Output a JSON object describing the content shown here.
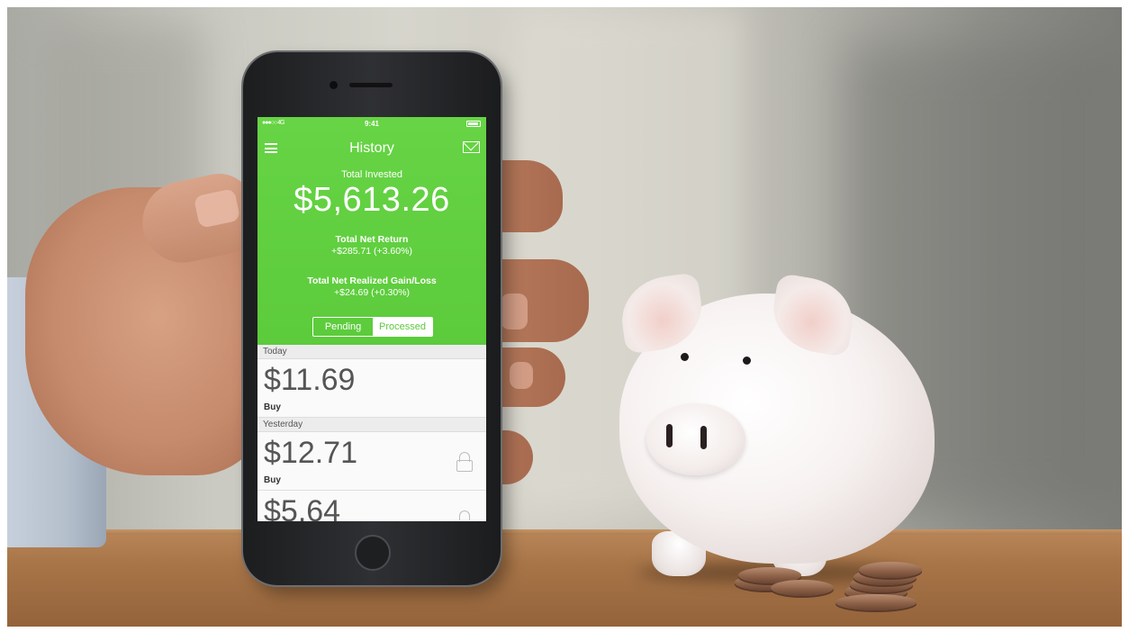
{
  "status_bar": {
    "signal": "●●●○○ 4G",
    "time": "9:41"
  },
  "nav": {
    "title": "History"
  },
  "summary": {
    "total_invested_label": "Total Invested",
    "total_invested_value": "$5,613.26",
    "net_return_label": "Total Net Return",
    "net_return_value": "+$285.71 (+3.60%)",
    "realized_label": "Total Net Realized Gain/Loss",
    "realized_value": "+$24.69 (+0.30%)"
  },
  "tabs": {
    "pending": "Pending",
    "processed": "Processed",
    "selected": "processed"
  },
  "history": {
    "sections": [
      {
        "header": "Today",
        "amount": "$11.69",
        "type": "Buy",
        "locked": false
      },
      {
        "header": "Yesterday",
        "amount": "$12.71",
        "type": "Buy",
        "locked": true
      }
    ],
    "partial_amount": "$5.64"
  },
  "colors": {
    "accent_green": "#5ccb3c",
    "screen_text": "#ffffff"
  },
  "icons": {
    "menu": "hamburger-icon",
    "mail": "mail-icon",
    "lock": "lock-icon"
  }
}
